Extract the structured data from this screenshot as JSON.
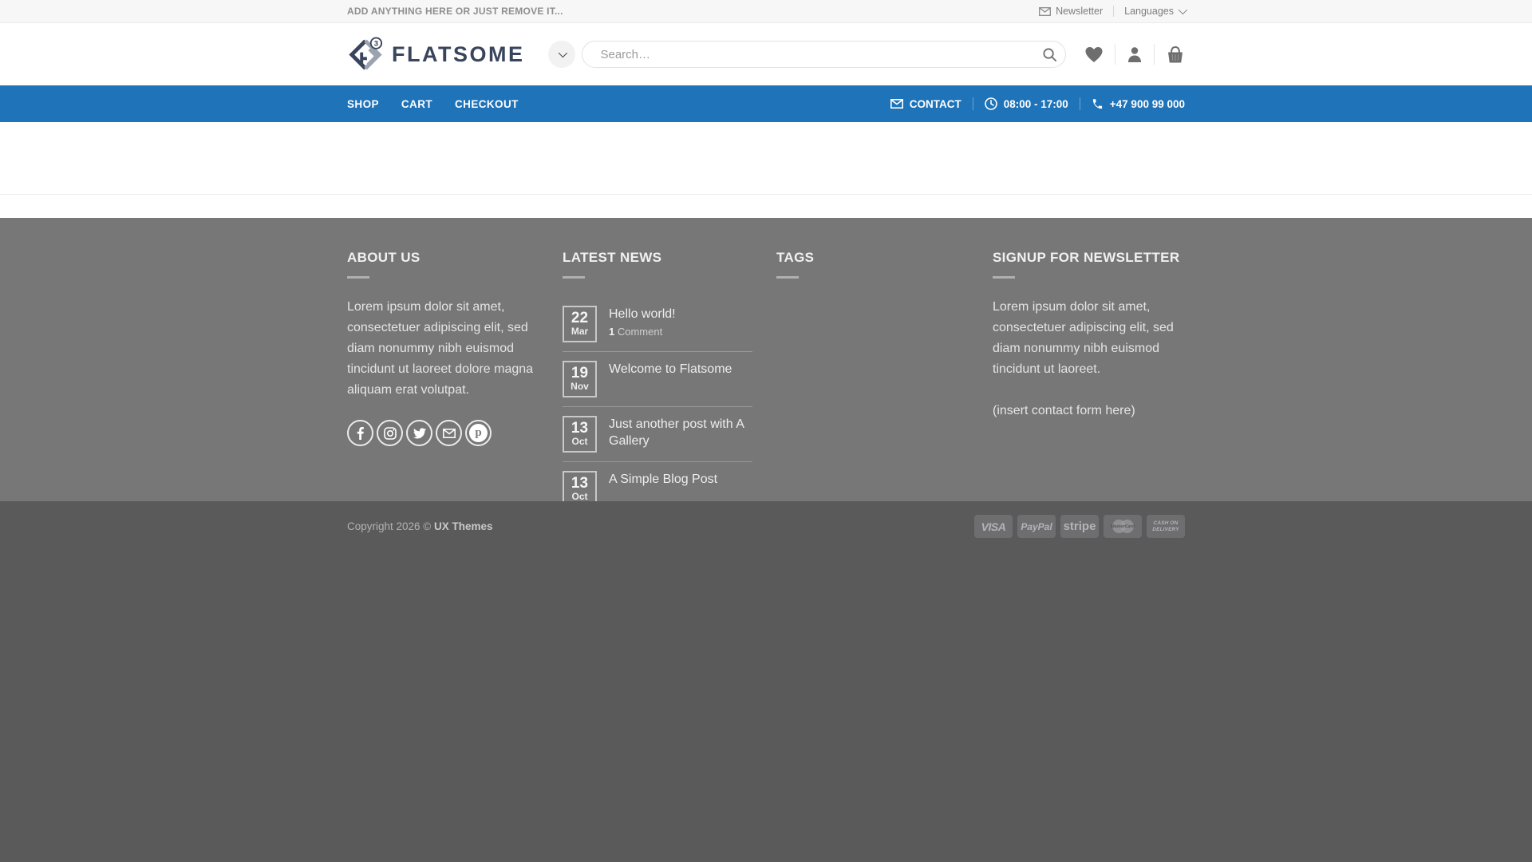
{
  "topbar": {
    "left_text": "ADD ANYTHING HERE OR JUST REMOVE IT...",
    "newsletter_label": "Newsletter",
    "languages_label": "Languages"
  },
  "header": {
    "logo_text": "FLATSOME",
    "logo_badge": "3",
    "search_placeholder": "Search…",
    "icons": [
      "chevron-down-icon",
      "search-icon",
      "wishlist-heart-icon",
      "account-icon",
      "cart-basket-icon"
    ]
  },
  "nav": {
    "items": [
      {
        "label": "SHOP"
      },
      {
        "label": "CART"
      },
      {
        "label": "CHECKOUT"
      }
    ],
    "contact_label": "CONTACT",
    "hours": "08:00 - 17:00",
    "phone": "+47 900 99 000"
  },
  "footer": {
    "about": {
      "title": "ABOUT US",
      "text": "Lorem ipsum dolor sit amet, consectetuer adipiscing elit, sed diam nonummy nibh euismod tincidunt ut laoreet dolore magna aliquam erat volutpat."
    },
    "social": [
      {
        "name": "facebook-icon"
      },
      {
        "name": "instagram-icon"
      },
      {
        "name": "twitter-icon"
      },
      {
        "name": "email-icon"
      },
      {
        "name": "pinterest-icon"
      }
    ],
    "latest_news": {
      "title": "LATEST NEWS",
      "posts": [
        {
          "day": "22",
          "month": "Mar",
          "title": "Hello world!",
          "meta_count": "1",
          "meta_label": " Comment"
        },
        {
          "day": "19",
          "month": "Nov",
          "title": "Welcome to Flatsome"
        },
        {
          "day": "13",
          "month": "Oct",
          "title": "Just another post with A Gallery"
        },
        {
          "day": "13",
          "month": "Oct",
          "title": "A Simple Blog Post"
        }
      ]
    },
    "tags": {
      "title": "TAGS"
    },
    "signup": {
      "title": "SIGNUP FOR NEWSLETTER",
      "text": "Lorem ipsum dolor sit amet, consectetuer adipiscing elit, sed diam nonummy nibh euismod tincidunt ut laoreet.",
      "note": "(insert contact form here)"
    }
  },
  "absolute_footer": {
    "copyright_prefix": "Copyright 2026 © ",
    "copyright_brand": "UX Themes",
    "payments": [
      {
        "name": "visa",
        "label": "VISA"
      },
      {
        "name": "paypal",
        "label": "PayPal"
      },
      {
        "name": "stripe",
        "label": "stripe"
      },
      {
        "name": "mastercard",
        "label": "MasterCard"
      },
      {
        "name": "cash-on-delivery",
        "label_line1": "CASH ON",
        "label_line2": "DELIVERY"
      }
    ]
  },
  "colors": {
    "nav_blue": "#1f73b8",
    "footer_gray": "#777777",
    "absolute_footer_gray": "#5a5a5a",
    "logo_navy": "#39455c",
    "logo_gray": "#9aa3af"
  }
}
